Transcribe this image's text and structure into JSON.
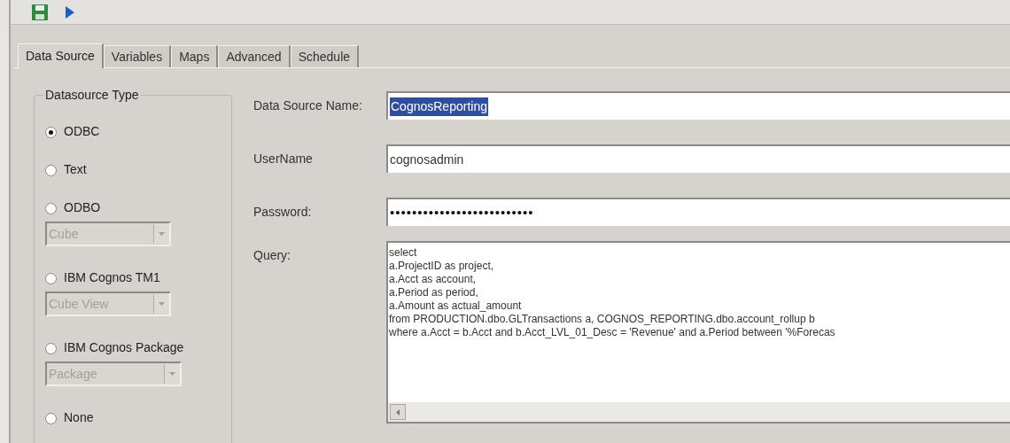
{
  "toolbar": {
    "buttons": [
      {
        "kind": "save"
      },
      {
        "kind": "run"
      }
    ]
  },
  "tabs": [
    {
      "label": "Data Source",
      "selected": true
    },
    {
      "label": "Variables",
      "selected": false
    },
    {
      "label": "Maps",
      "selected": false
    },
    {
      "label": "Advanced",
      "selected": false
    },
    {
      "label": "Schedule",
      "selected": false
    }
  ],
  "datasource_type": {
    "title": "Datasource Type",
    "options": [
      {
        "label": "ODBC",
        "selected": true
      },
      {
        "label": "Text",
        "selected": false
      },
      {
        "label": "ODBO",
        "selected": false,
        "dropdown": {
          "value": "Cube",
          "disabled": true
        }
      },
      {
        "label": "IBM Cognos TM1",
        "selected": false,
        "dropdown": {
          "value": "Cube View",
          "disabled": true
        }
      },
      {
        "label": "IBM Cognos Package",
        "selected": false,
        "dropdown": {
          "value": "Package",
          "disabled": true
        }
      },
      {
        "label": "None",
        "selected": false
      }
    ]
  },
  "fields": [
    {
      "kind": "text",
      "label": "Data Source Name:",
      "value": "CognosReporting",
      "text_selected": true
    },
    {
      "kind": "text",
      "label": "UserName",
      "value": "cognosadmin",
      "text_selected": false
    },
    {
      "kind": "password",
      "label": "Password:",
      "value": "••••••••••••••••••••••••••",
      "text_selected": false
    },
    {
      "kind": "query",
      "label": "Query:",
      "lines": [
        "select",
        "a.ProjectID as project,",
        "a.Acct as account,",
        "a.Period as period,",
        "a.Amount as actual_amount",
        "from PRODUCTION.dbo.GLTransactions a, COGNOS_REPORTING.dbo.account_rollup b",
        "where a.Acct = b.Acct and b.Acct_LVL_01_Desc = 'Revenue' and a.Period between '%Forecas"
      ]
    }
  ]
}
